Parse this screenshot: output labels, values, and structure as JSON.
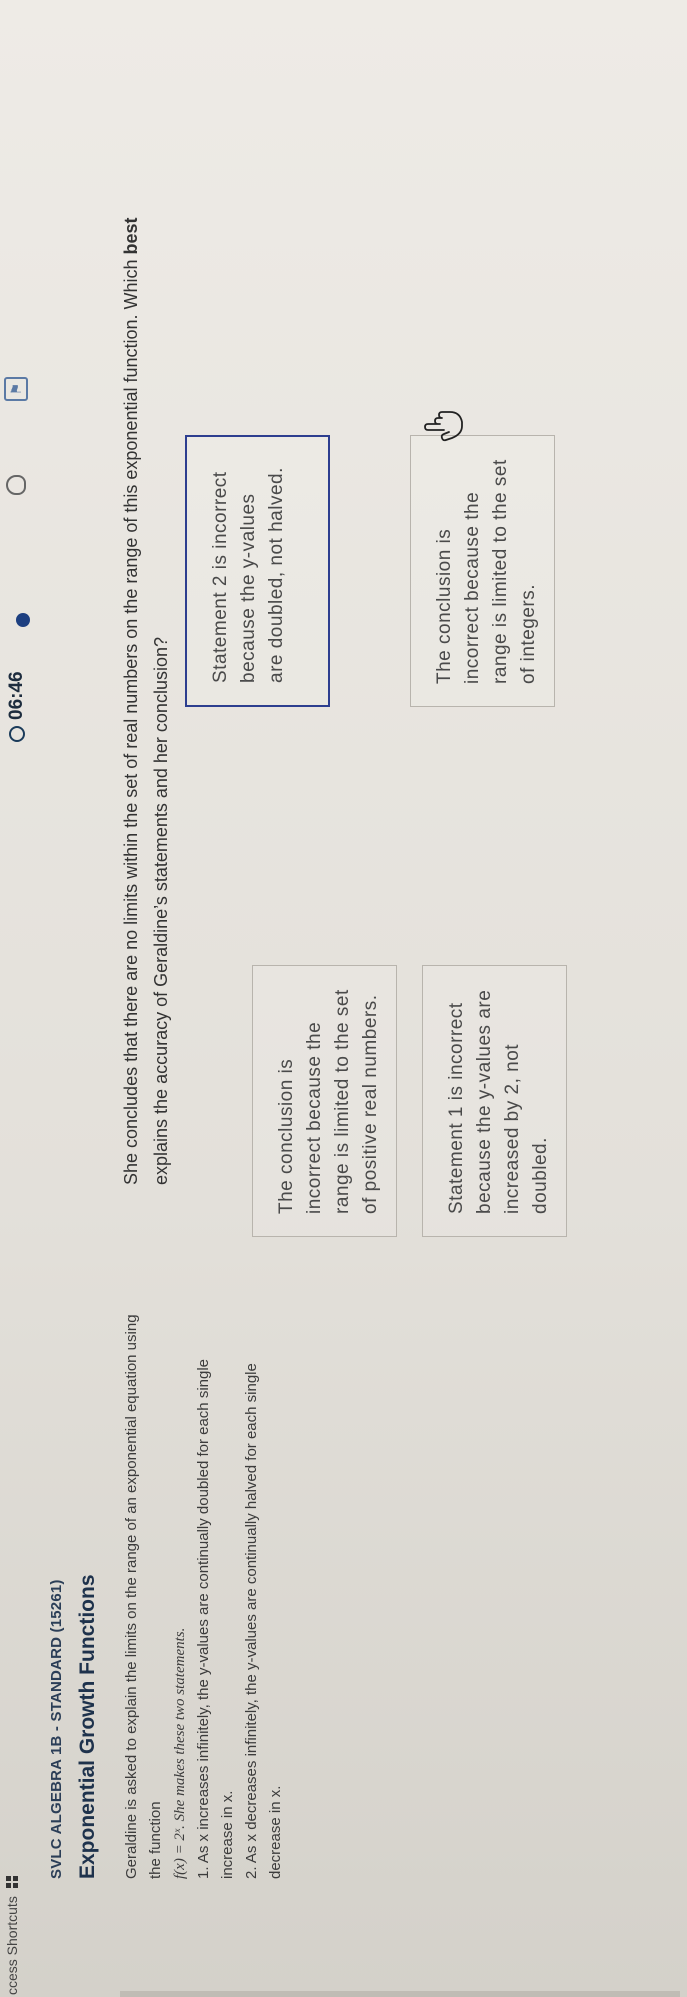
{
  "topbar": {
    "shortcuts_label": "ccess Shortcuts",
    "timer": "06:46"
  },
  "course_label": "SVLC ALGEBRA 1B - STANDARD (15261)",
  "lesson_title": "Exponential Growth Functions",
  "question": {
    "intro": "Geraldine is asked to explain the limits on the range of an exponential equation using the function",
    "function_text": "f(x) = 2ˣ. She makes these two statements.",
    "statement1": "1. As x increases infinitely, the y-values are continually doubled for each single increase in x.",
    "statement2": "2. As x decreases infinitely, the y-values are continually halved for each single decrease in x.",
    "prompt_part1": "She concludes that there are no limits within the set of real numbers on the range of this exponential function. Which ",
    "prompt_bold": "best",
    "prompt_part2": " explains the accuracy of Geraldine’s statements and her conclusion?"
  },
  "choices": [
    {
      "text": "The conclusion is incorrect because the range is limited to the set of positive real numbers."
    },
    {
      "text": "Statement 2 is incorrect because the y-values are doubled, not halved."
    },
    {
      "text": "Statement 1 is incorrect because the y-values are increased by 2, not doubled."
    },
    {
      "text": "The conclusion is incorrect because the range is limited to the set of integers."
    }
  ],
  "icons": {
    "timer": "timer-icon",
    "hint": "lightbulb-icon",
    "flag": "flag-icon",
    "cursor": "hand-cursor-icon"
  },
  "colors": {
    "selected_border": "#2d3e8f",
    "title": "#1e324c",
    "timer_dot": "#1d3f80"
  }
}
